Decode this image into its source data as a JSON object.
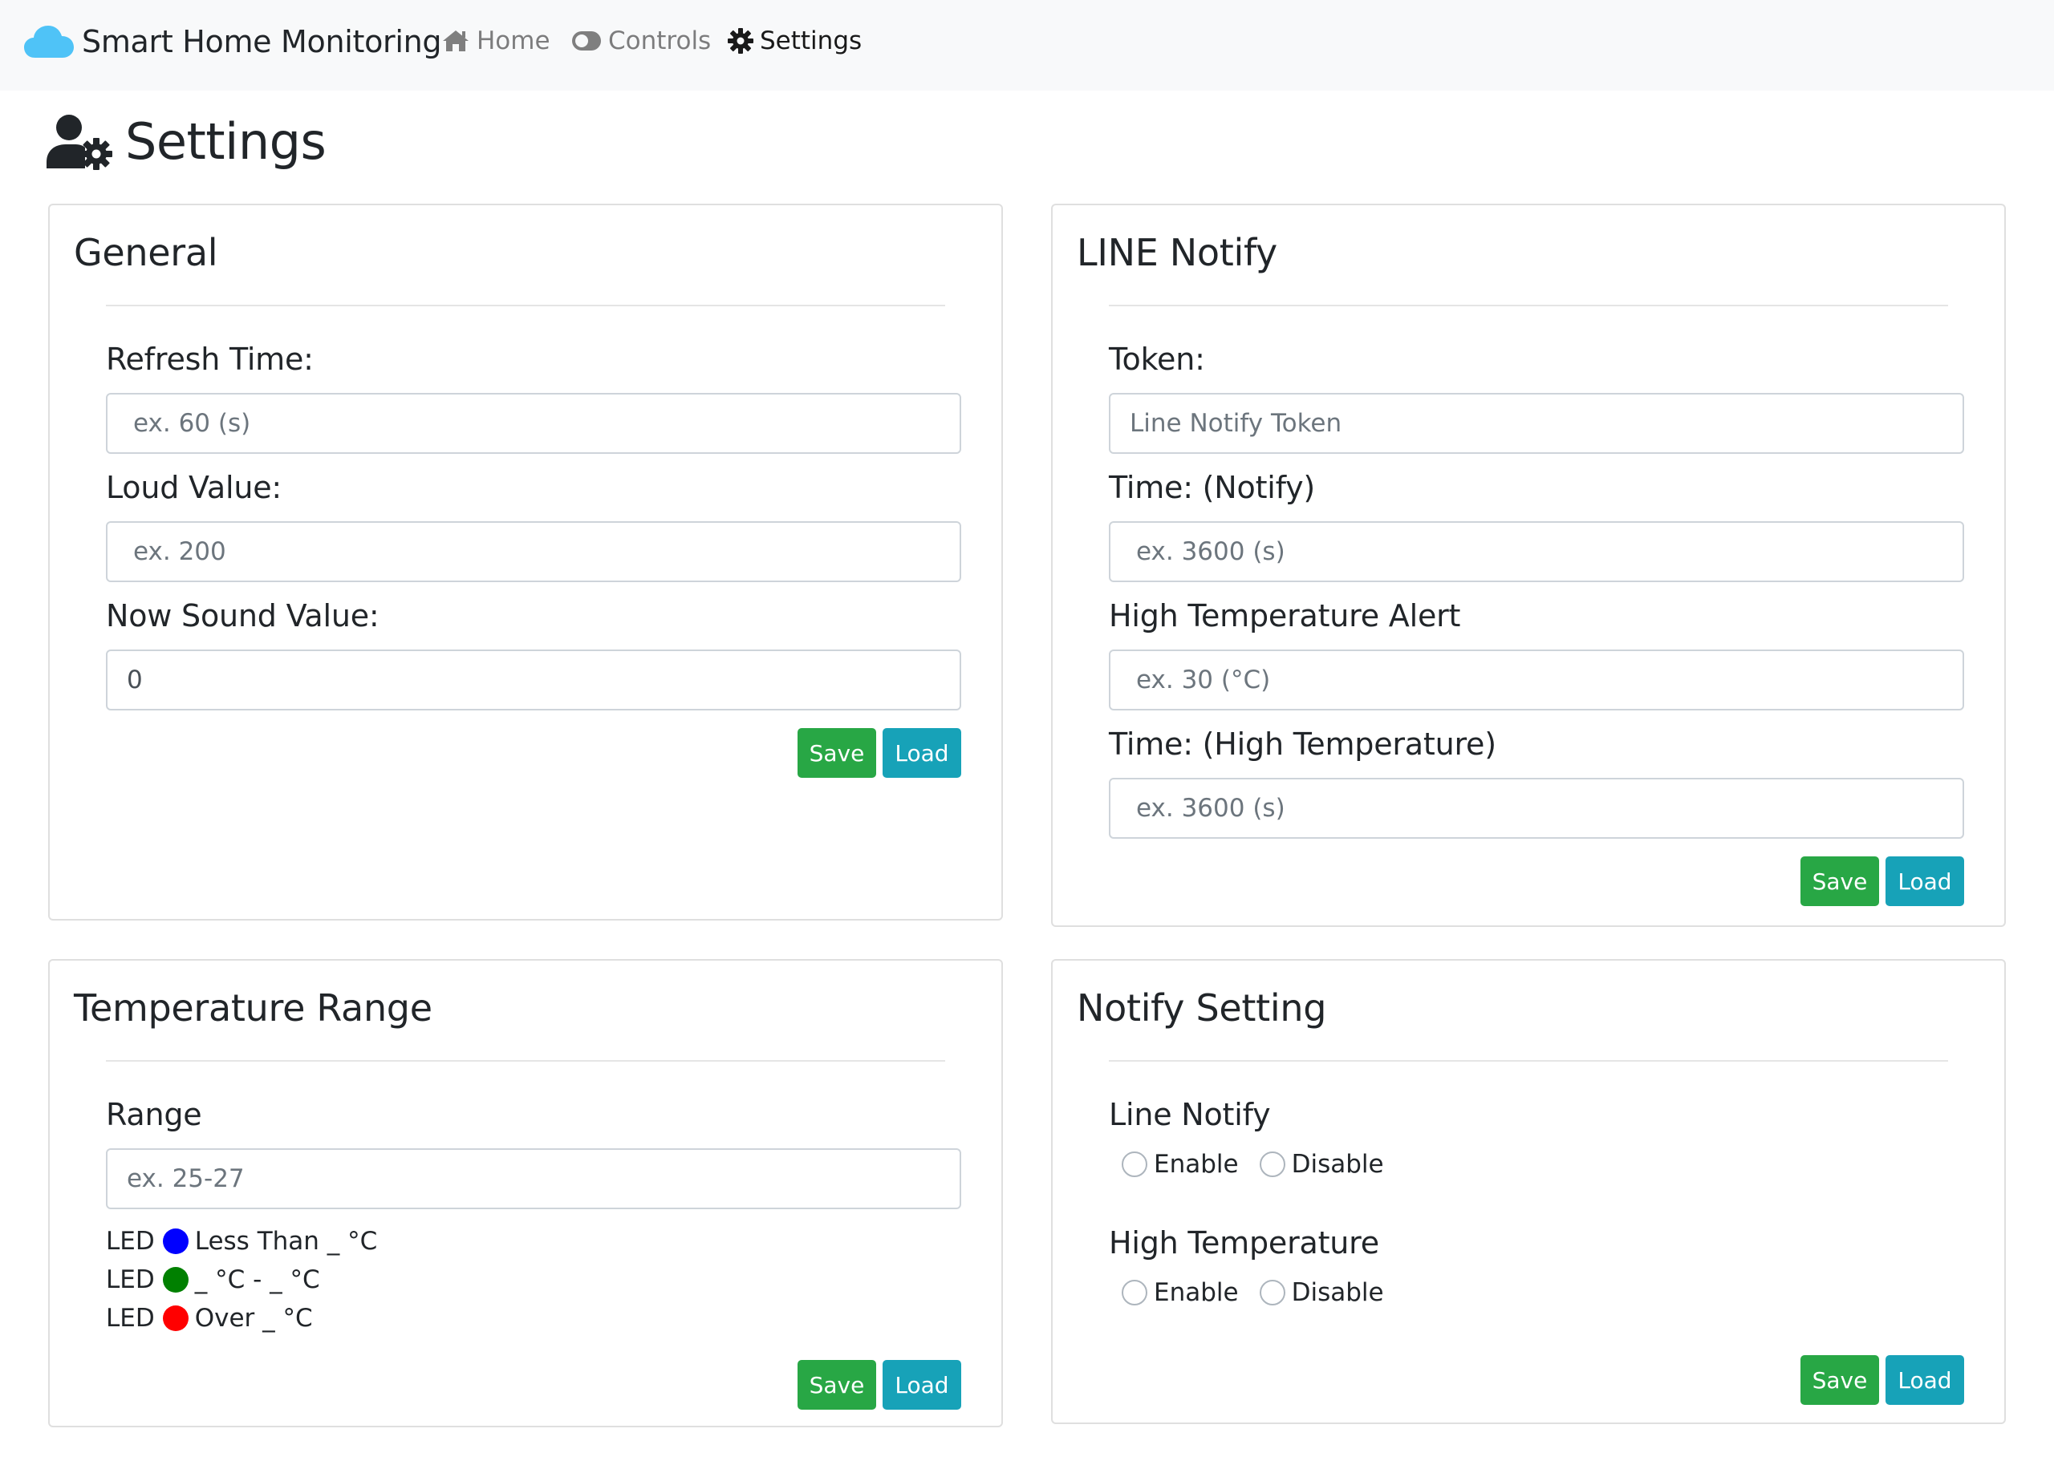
{
  "nav": {
    "brand": "Smart Home Monitoring",
    "items": [
      {
        "label": "Home",
        "icon": "home-icon",
        "active": false
      },
      {
        "label": "Controls",
        "icon": "toggle-icon",
        "active": false
      },
      {
        "label": "Settings",
        "icon": "gear-icon",
        "active": true
      }
    ]
  },
  "page": {
    "title": "Settings",
    "icon": "user-cog-icon"
  },
  "general": {
    "title": "General",
    "refresh_label": "Refresh Time:",
    "refresh_placeholder": "ex. 60 (s)",
    "loud_label": "Loud Value:",
    "loud_placeholder": "ex. 200",
    "sound_label": "Now Sound Value:",
    "sound_value": "0",
    "save": "Save",
    "load": "Load"
  },
  "line_notify": {
    "title": "LINE Notify",
    "token_label": "Token:",
    "token_placeholder": "Line Notify Token",
    "time_label": "Time: (Notify)",
    "time_placeholder": "ex. 3600 (s)",
    "alert_label": "High Temperature Alert",
    "alert_placeholder": "ex. 30 (°C)",
    "high_time_label": "Time: (High Temperature)",
    "high_time_placeholder": "ex. 3600 (s)",
    "save": "Save",
    "load": "Load"
  },
  "temp_range": {
    "title": "Temperature Range",
    "range_label": "Range",
    "range_placeholder": "ex. 25-27",
    "leds": [
      {
        "prefix": "LED",
        "color": "#0000ff",
        "text": "Less Than _ °C"
      },
      {
        "prefix": "LED",
        "color": "#008000",
        "text": "_ °C - _ °C"
      },
      {
        "prefix": "LED",
        "color": "#ff0000",
        "text": "Over _ °C"
      }
    ],
    "save": "Save",
    "load": "Load"
  },
  "notify_setting": {
    "title": "Notify Setting",
    "line_label": "Line Notify",
    "high_label": "High Temperature",
    "enable": "Enable",
    "disable": "Disable",
    "save": "Save",
    "load": "Load"
  },
  "colors": {
    "brand_cloud": "#4fc3f7",
    "save_btn": "#28a745",
    "load_btn": "#17a2b8",
    "navbar_bg": "#f8f9fa"
  }
}
